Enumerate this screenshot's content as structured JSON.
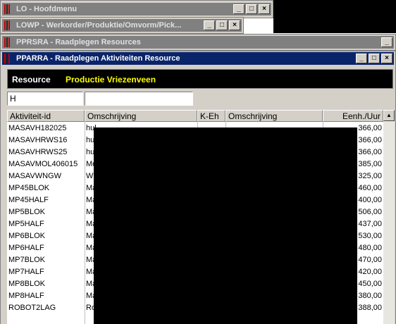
{
  "windows": [
    {
      "title": "LO - Hoofdmenu"
    },
    {
      "title": "LOWP - Werkorder/Produktie/Omvorm/Pick..."
    },
    {
      "title": "PPRSRA - Raadplegen Resources"
    },
    {
      "title": "PPARRA - Raadplegen Aktiviteiten Resource"
    }
  ],
  "controls": {
    "minimize": "_",
    "maximize": "□",
    "close": "×"
  },
  "resource": {
    "label": "Resource",
    "value": "Productie Vriezenveen"
  },
  "filter": {
    "first_value": "H",
    "second_value": ""
  },
  "grid": {
    "headers": [
      "Aktiviteit-id",
      "Omschrijving",
      "K-Eh",
      "Omschrijving",
      "Eenh./Uur"
    ],
    "rows": [
      {
        "id": "MASAVH182025",
        "desc": "hul",
        "keh": "",
        "desc2": "",
        "rate": "366,00"
      },
      {
        "id": "MASAVHRWS16",
        "desc": "hul",
        "keh": "",
        "desc2": "",
        "rate": "366,00"
      },
      {
        "id": "MASAVHRWS25",
        "desc": "hul",
        "keh": "",
        "desc2": "",
        "rate": "366,00"
      },
      {
        "id": "MASAVMOL406015",
        "desc": "Mo",
        "keh": "",
        "desc2": "",
        "rate": "385,00"
      },
      {
        "id": "MASAVWNGW",
        "desc": "Wi",
        "keh": "",
        "desc2": "",
        "rate": "325,00"
      },
      {
        "id": "MP45BLOK",
        "desc": "Ma",
        "keh": "",
        "desc2": "",
        "rate": "460,00"
      },
      {
        "id": "MP45HALF",
        "desc": "Ma",
        "keh": "",
        "desc2": "",
        "rate": "400,00"
      },
      {
        "id": "MP5BLOK",
        "desc": "Ma",
        "keh": "",
        "desc2": "",
        "rate": "506,00"
      },
      {
        "id": "MP5HALF",
        "desc": "Ma",
        "keh": "",
        "desc2": "",
        "rate": "437,00"
      },
      {
        "id": "MP6BLOK",
        "desc": "Ma",
        "keh": "",
        "desc2": "",
        "rate": "530,00"
      },
      {
        "id": "MP6HALF",
        "desc": "Ma",
        "keh": "",
        "desc2": "",
        "rate": "480,00"
      },
      {
        "id": "MP7BLOK",
        "desc": "Ma",
        "keh": "",
        "desc2": "",
        "rate": "470,00"
      },
      {
        "id": "MP7HALF",
        "desc": "Ma",
        "keh": "",
        "desc2": "",
        "rate": "420,00"
      },
      {
        "id": "MP8BLOK",
        "desc": "Ma",
        "keh": "",
        "desc2": "",
        "rate": "450,00"
      },
      {
        "id": "MP8HALF",
        "desc": "Ma",
        "keh": "",
        "desc2": "",
        "rate": "380,00"
      },
      {
        "id": "ROBOT2LAG",
        "desc": "Ro",
        "keh": "",
        "desc2": "",
        "rate": "388,00"
      }
    ]
  },
  "scrollbar": {
    "up": "▲"
  },
  "colors": {
    "active_title": "#0a246a",
    "inactive_title": "#808080",
    "resource_value": "#ffff00"
  }
}
